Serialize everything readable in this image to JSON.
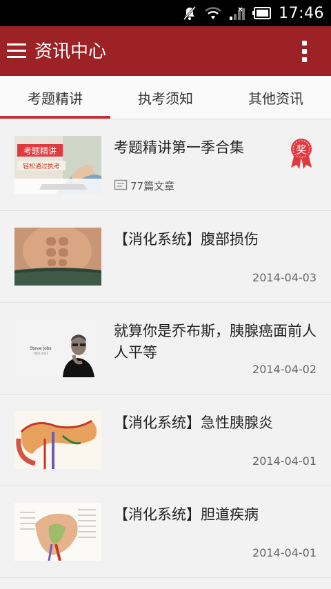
{
  "status_bar": {
    "time": "17:46",
    "icons": [
      "mute-icon",
      "wifi-icon",
      "signal-icon",
      "battery-icon"
    ]
  },
  "app_bar": {
    "title": "资讯中心",
    "menu_icon": "hamburger-menu-icon",
    "more_icon": "overflow-menu-icon",
    "color": "#9c2226"
  },
  "tabs": [
    {
      "label": "考题精讲",
      "selected": true
    },
    {
      "label": "执考须知",
      "selected": false
    },
    {
      "label": "其他资讯",
      "selected": false
    }
  ],
  "articles": [
    {
      "title": "考题精讲第一季合集",
      "count_label": "77篇文章",
      "badge": "奖",
      "thumb_text_1": "考题精讲",
      "thumb_text_2": "轻松通过执考"
    },
    {
      "title": "【消化系统】腹部损伤",
      "date": "2014-04-03"
    },
    {
      "title": "就算你是乔布斯，胰腺癌面前人人平等",
      "date": "2014-04-02",
      "thumb_text_1": "Steve Jobs",
      "thumb_text_2": "1955-2011"
    },
    {
      "title": "【消化系统】急性胰腺炎",
      "date": "2014-04-01"
    },
    {
      "title": "【消化系统】胆道疾病",
      "date": "2014-04-01"
    }
  ],
  "colors": {
    "accent": "#c23036",
    "badge": "#e0393f"
  }
}
